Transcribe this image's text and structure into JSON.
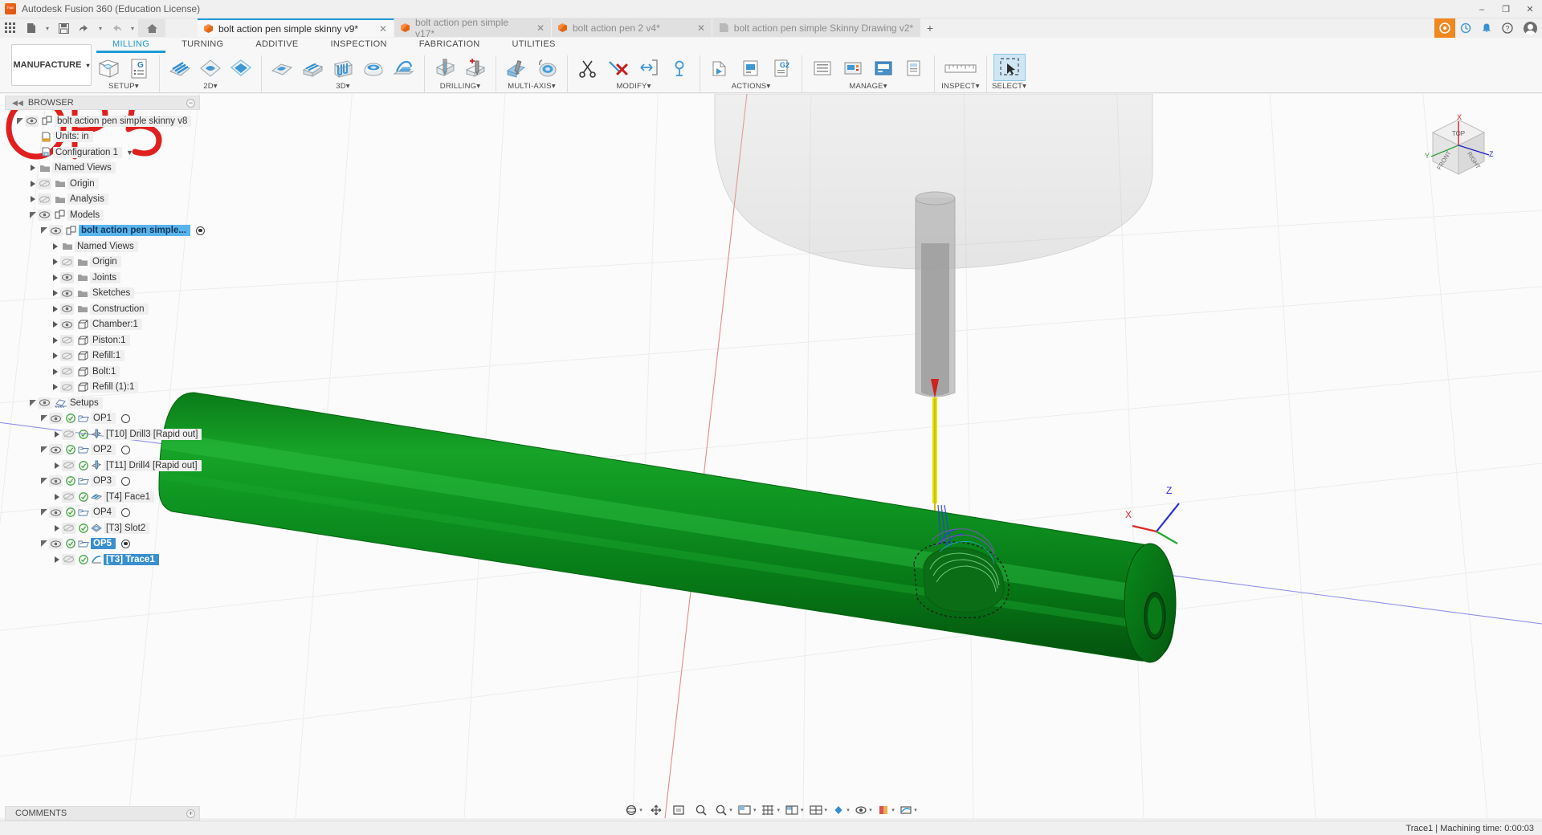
{
  "window": {
    "title": "Autodesk Fusion 360 (Education License)",
    "logo_icon": "fusion360-logo-icon",
    "minimize": "–",
    "maximize": "❐",
    "close": "✕"
  },
  "quick_access": {
    "grid_icon": "app-grid-icon",
    "new_icon": "new-file-icon",
    "save_icon": "save-icon",
    "undo_icon": "undo-icon",
    "redo_icon": "redo-icon",
    "home_icon": "home-icon",
    "caret": "▾"
  },
  "tabs": [
    {
      "label": "bolt action pen simple skinny v9*",
      "icon": "model-cube-icon",
      "active": true,
      "closable": true
    },
    {
      "label": "bolt action pen simple v17*",
      "icon": "model-cube-icon",
      "active": false,
      "closable": true
    },
    {
      "label": "bolt action pen 2 v4*",
      "icon": "model-cube-icon",
      "active": false,
      "closable": true
    },
    {
      "label": "bolt action pen simple Skinny Drawing v2*",
      "icon": "drawing-icon",
      "active": false,
      "closable": false
    }
  ],
  "tab_add_label": "+",
  "right_icons": {
    "extension_icon": "extension-icon",
    "job_status_icon": "job-status-icon",
    "notification_icon": "bell-icon",
    "help_icon": "help-icon",
    "account_icon": "user-avatar-icon"
  },
  "ribbon": {
    "workspace": "MANUFACTURE",
    "workspace_caret": "▾",
    "tabs": [
      {
        "label": "MILLING",
        "active": true
      },
      {
        "label": "TURNING",
        "active": false
      },
      {
        "label": "ADDITIVE",
        "active": false
      },
      {
        "label": "INSPECTION",
        "active": false
      },
      {
        "label": "FABRICATION",
        "active": false
      },
      {
        "label": "UTILITIES",
        "active": false
      }
    ],
    "panels": [
      {
        "label": "SETUP",
        "caret": "▾",
        "tools": [
          "setup-icon",
          "ncprogram-icon"
        ]
      },
      {
        "label": "2D",
        "caret": "▾",
        "tools": [
          "face-icon",
          "adaptive2d-icon",
          "pocket2d-icon"
        ]
      },
      {
        "label": "3D",
        "caret": "▾",
        "tools": [
          "adaptive3d-icon",
          "pocket3d-icon",
          "parallel-icon",
          "contour3d-icon",
          "scallop-icon"
        ]
      },
      {
        "label": "DRILLING",
        "caret": "▾",
        "tools": [
          "drill-icon",
          "boremill-icon"
        ]
      },
      {
        "label": "MULTI-AXIS",
        "caret": "▾",
        "tools": [
          "swarf-icon",
          "multiaxis-contour-icon"
        ]
      },
      {
        "label": "MODIFY",
        "caret": "▾",
        "tools": [
          "trim-icon",
          "delete-icon",
          "extend-icon",
          "toolpath-transform-icon"
        ]
      },
      {
        "label": "ACTIONS",
        "caret": "▾",
        "tools": [
          "simulate-icon",
          "post-process-icon",
          "setup-sheet-icon"
        ]
      },
      {
        "label": "MANAGE",
        "caret": "▾",
        "tools": [
          "tool-library-icon",
          "machine-library-icon",
          "generate-icon",
          "template-icon"
        ]
      },
      {
        "label": "INSPECT",
        "caret": "▾",
        "tools": [
          "measure-icon"
        ]
      },
      {
        "label": "SELECT",
        "caret": "▾",
        "tools": [
          "select-icon"
        ],
        "selected": true
      }
    ]
  },
  "browser": {
    "header": "BROWSER",
    "collapse_icon": "collapse-left-icon",
    "options_icon": "panel-options-icon",
    "tree": [
      {
        "indent": 0,
        "label": "bolt action pen simple skinny v8",
        "arrow": "open",
        "eye": "visible",
        "icon": "component-icon"
      },
      {
        "indent": 1,
        "label": "Units: in",
        "arrow": "none",
        "eye": "none",
        "icon": "units-icon"
      },
      {
        "indent": 1,
        "label": "Configuration 1",
        "arrow": "none",
        "eye": "none",
        "icon": "configuration-icon",
        "dropdown": true
      },
      {
        "indent": 1,
        "label": "Named Views",
        "arrow": "closed",
        "eye": "none",
        "icon": "folder-icon"
      },
      {
        "indent": 1,
        "label": "Origin",
        "arrow": "closed",
        "eye": "hidden",
        "icon": "folder-icon"
      },
      {
        "indent": 1,
        "label": "Analysis",
        "arrow": "closed",
        "eye": "hidden",
        "icon": "folder-icon"
      },
      {
        "indent": 1,
        "label": "Models",
        "arrow": "open",
        "eye": "visible",
        "icon": "component-icon"
      },
      {
        "indent": 2,
        "label": "bolt action pen simple...",
        "arrow": "open",
        "eye": "visible",
        "icon": "component-icon",
        "selected": true,
        "circledot": true
      },
      {
        "indent": 3,
        "label": "Named Views",
        "arrow": "closed",
        "eye": "none",
        "icon": "folder-icon"
      },
      {
        "indent": 3,
        "label": "Origin",
        "arrow": "closed",
        "eye": "hidden",
        "icon": "folder-icon"
      },
      {
        "indent": 3,
        "label": "Joints",
        "arrow": "closed",
        "eye": "visible",
        "icon": "folder-icon"
      },
      {
        "indent": 3,
        "label": "Sketches",
        "arrow": "closed",
        "eye": "visible",
        "icon": "folder-icon"
      },
      {
        "indent": 3,
        "label": "Construction",
        "arrow": "closed",
        "eye": "visible",
        "icon": "folder-icon"
      },
      {
        "indent": 3,
        "label": "Chamber:1",
        "arrow": "closed",
        "eye": "visible",
        "icon": "body-icon"
      },
      {
        "indent": 3,
        "label": "Piston:1",
        "arrow": "closed",
        "eye": "hidden",
        "icon": "body-icon"
      },
      {
        "indent": 3,
        "label": "Refill:1",
        "arrow": "closed",
        "eye": "hidden",
        "icon": "body-icon"
      },
      {
        "indent": 3,
        "label": "Bolt:1",
        "arrow": "closed",
        "eye": "hidden",
        "icon": "body-icon"
      },
      {
        "indent": 3,
        "label": "Refill (1):1",
        "arrow": "closed",
        "eye": "hidden",
        "icon": "body-icon"
      },
      {
        "indent": 1,
        "label": "Setups",
        "arrow": "open",
        "eye": "visible",
        "icon": "setups-icon",
        "hatched": true
      },
      {
        "indent": 2,
        "label": "OP1",
        "arrow": "open",
        "eye": "visible",
        "icon": "setup-folder-icon",
        "check": true,
        "circle": true
      },
      {
        "indent": 3,
        "label": "[T10] Drill3 [Rapid out]",
        "arrow": "closed",
        "eye": "hidden",
        "icon": "drill-op-icon",
        "check": true
      },
      {
        "indent": 2,
        "label": "OP2",
        "arrow": "open",
        "eye": "visible",
        "icon": "setup-folder-icon",
        "check": true,
        "circle": true
      },
      {
        "indent": 3,
        "label": "[T11] Drill4 [Rapid out]",
        "arrow": "closed",
        "eye": "hidden",
        "icon": "drill-op-icon",
        "check": true
      },
      {
        "indent": 2,
        "label": "OP3",
        "arrow": "open",
        "eye": "visible",
        "icon": "setup-folder-icon",
        "check": true,
        "circle": true
      },
      {
        "indent": 3,
        "label": "[T4] Face1",
        "arrow": "closed",
        "eye": "hidden",
        "icon": "face-op-icon",
        "check": true
      },
      {
        "indent": 2,
        "label": "OP4",
        "arrow": "open",
        "eye": "visible",
        "icon": "setup-folder-icon",
        "check": true,
        "circle": true
      },
      {
        "indent": 3,
        "label": "[T3] Slot2",
        "arrow": "closed",
        "eye": "hidden",
        "icon": "slot-op-icon",
        "check": true
      },
      {
        "indent": 2,
        "label": "OP5",
        "arrow": "open",
        "eye": "visible",
        "icon": "setup-folder-icon",
        "check": true,
        "circledot": true,
        "selected_op": true
      },
      {
        "indent": 3,
        "label": "[T3] Trace1",
        "arrow": "closed",
        "eye": "hidden",
        "icon": "trace-op-icon",
        "check": true,
        "selected_op": true
      }
    ]
  },
  "comments": {
    "label": "COMMENTS",
    "expand_icon": "panel-expand-icon"
  },
  "canvas": {
    "annotation": "OP5",
    "annotation_color": "#e02020",
    "navcube_top": "TOP",
    "navcube_front": "FRONT",
    "navcube_right": "RIGHT",
    "axis_x": "X",
    "axis_y": "Y",
    "axis_z": "Z",
    "triad_x": "X",
    "triad_z": "Z",
    "body_color": "#0d8a1d"
  },
  "bottom_toolbar": {
    "items": [
      {
        "icon": "orbit-icon",
        "caret": "▾"
      },
      {
        "icon": "pan-icon",
        "caret": ""
      },
      {
        "icon": "zoom-icon",
        "caret": ""
      },
      {
        "icon": "fit-icon",
        "caret": ""
      },
      {
        "icon": "zoom-window-icon",
        "caret": "▾"
      },
      {
        "icon": "display-mode-icon",
        "caret": "▾"
      },
      {
        "icon": "grid-snap-icon",
        "caret": "▾"
      },
      {
        "icon": "viewports-icon",
        "caret": "▾"
      },
      {
        "icon": "layout-grid-icon",
        "caret": "▾"
      },
      {
        "icon": "effects-icon",
        "caret": "▾"
      },
      {
        "icon": "object-visibility-icon",
        "caret": "▾"
      },
      {
        "icon": "component-color-icon",
        "caret": "▾"
      },
      {
        "icon": "toolpath-display-icon",
        "caret": "▾"
      }
    ]
  },
  "status": {
    "right_text": "Trace1 | Machining time: 0:00:03"
  }
}
